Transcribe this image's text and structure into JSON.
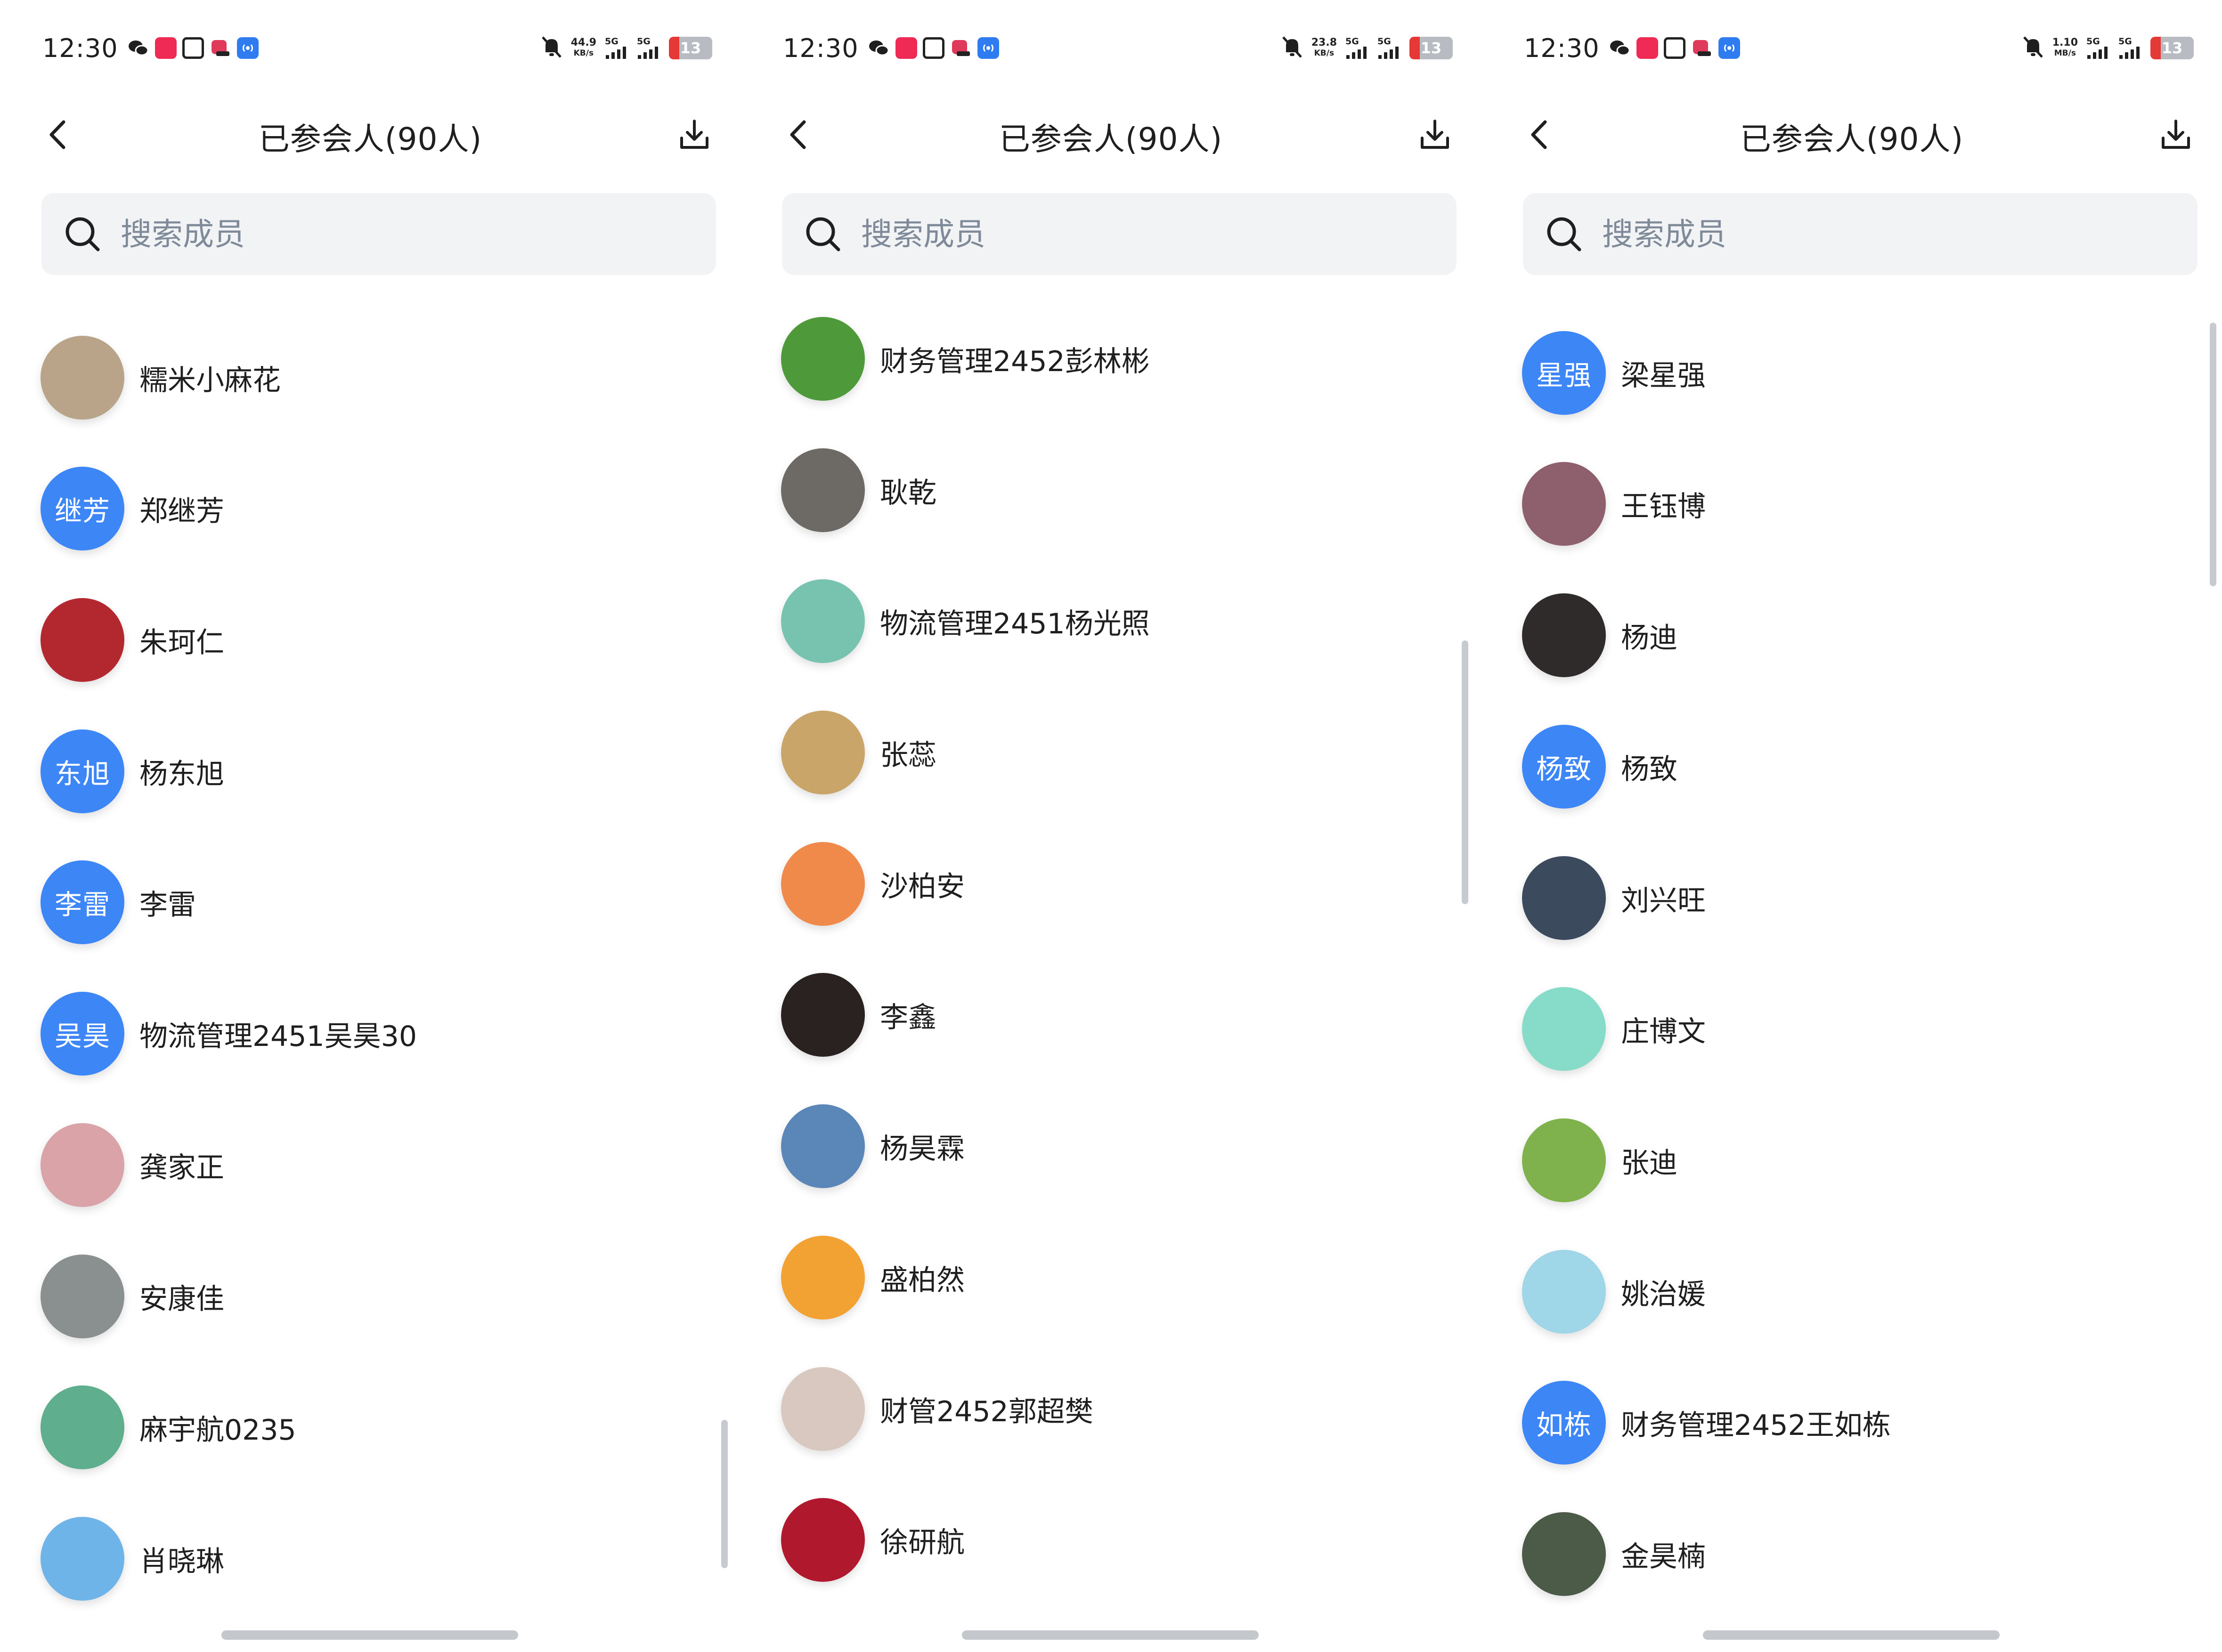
{
  "status_bar": {
    "time": "12:30",
    "network_label": "5G",
    "notification_icons": [
      "wechat-icon",
      "red-app-icon",
      "document-icon",
      "pink-app-icon",
      "blue-broadcast-icon"
    ]
  },
  "header": {
    "back_icon": "chevron-left-icon",
    "title": "已参会人(90人)",
    "download_icon": "download-icon"
  },
  "search": {
    "placeholder": "搜索成员",
    "icon": "search-icon"
  },
  "colors": {
    "accent": "#3d86f6",
    "search_bg": "#f2f3f5",
    "placeholder": "#7f8a99"
  },
  "panels": [
    {
      "status": {
        "speed_value": "44.9",
        "speed_unit": "KB/s",
        "battery": "13"
      },
      "members": [
        {
          "name": "糯米小麻花",
          "avatar_text": "",
          "avatar_color": "#b9a48a"
        },
        {
          "name": "郑继芳",
          "avatar_text": "继芳"
        },
        {
          "name": "朱珂仁",
          "avatar_text": "",
          "avatar_color": "#b3282f"
        },
        {
          "name": "杨东旭",
          "avatar_text": "东旭"
        },
        {
          "name": "李雷",
          "avatar_text": "李雷"
        },
        {
          "name": "物流管理2451吴昊30",
          "avatar_text": "吴昊"
        },
        {
          "name": "龚家正",
          "avatar_text": "",
          "avatar_color": "#d9a3a8"
        },
        {
          "name": "安康佳",
          "avatar_text": "",
          "avatar_color": "#8a8f8f"
        },
        {
          "name": "麻宇航0235",
          "avatar_text": "",
          "avatar_color": "#5fae8e"
        },
        {
          "name": "肖晓琳",
          "avatar_text": "",
          "avatar_color": "#6fb4e8"
        }
      ]
    },
    {
      "status": {
        "speed_value": "23.8",
        "speed_unit": "KB/s",
        "battery": "13"
      },
      "members": [
        {
          "name": "财务管理2452彭林彬",
          "avatar_text": "",
          "avatar_color": "#4e9a3a"
        },
        {
          "name": "耿乾",
          "avatar_text": "",
          "avatar_color": "#6d6a66"
        },
        {
          "name": "物流管理2451杨光照",
          "avatar_text": "",
          "avatar_color": "#78c3b0"
        },
        {
          "name": "张蕊",
          "avatar_text": "",
          "avatar_color": "#c9a56a"
        },
        {
          "name": "沙柏安",
          "avatar_text": "",
          "avatar_color": "#f08a4b"
        },
        {
          "name": "李鑫",
          "avatar_text": "",
          "avatar_color": "#2a2220"
        },
        {
          "name": "杨昊霖",
          "avatar_text": "",
          "avatar_color": "#5b86b8"
        },
        {
          "name": "盛柏然",
          "avatar_text": "",
          "avatar_color": "#f2a233"
        },
        {
          "name": "财管2452郭超樊",
          "avatar_text": "",
          "avatar_color": "#d8c8bf"
        },
        {
          "name": "徐研航",
          "avatar_text": "",
          "avatar_color": "#b0182e"
        }
      ]
    },
    {
      "status": {
        "speed_value": "1.10",
        "speed_unit": "MB/s",
        "battery": "13"
      },
      "members": [
        {
          "name": "梁星强",
          "avatar_text": "星强"
        },
        {
          "name": "王钰博",
          "avatar_text": "",
          "avatar_color": "#8e5f6c"
        },
        {
          "name": "杨迪",
          "avatar_text": "",
          "avatar_color": "#2f2b2b"
        },
        {
          "name": "杨致",
          "avatar_text": "杨致"
        },
        {
          "name": "刘兴旺",
          "avatar_text": "",
          "avatar_color": "#3c4a5e"
        },
        {
          "name": "庄博文",
          "avatar_text": "",
          "avatar_color": "#86dcc8"
        },
        {
          "name": "张迪",
          "avatar_text": "",
          "avatar_color": "#7fb24c"
        },
        {
          "name": "姚治媛",
          "avatar_text": "",
          "avatar_color": "#9fd6e8"
        },
        {
          "name": "财务管理2452王如栋",
          "avatar_text": "如栋"
        },
        {
          "name": "金昊楠",
          "avatar_text": "",
          "avatar_color": "#4c5a48"
        }
      ]
    }
  ]
}
